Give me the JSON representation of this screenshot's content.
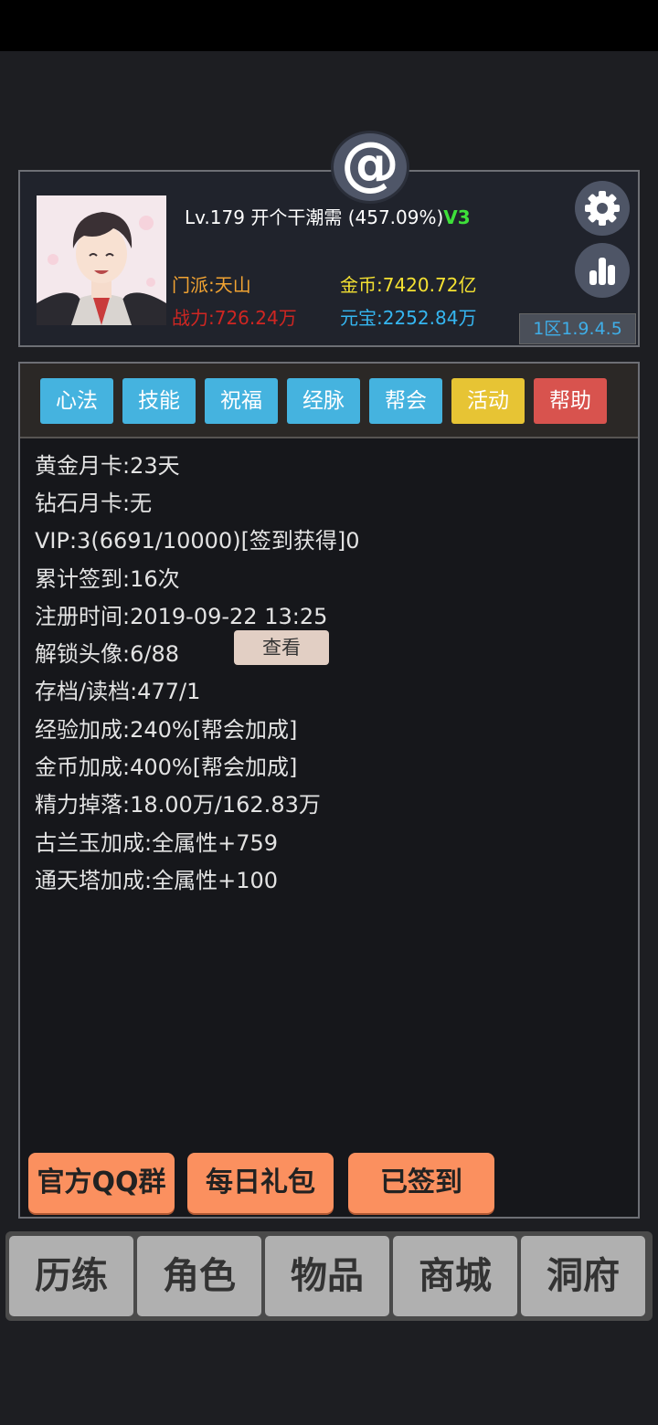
{
  "header": {
    "at_symbol": "@"
  },
  "profile": {
    "level": "Lv.179",
    "player_name": "开个干潮需",
    "exp_percent": "(457.09%)",
    "vip_tag": "V3",
    "sect": "门派:天山",
    "power": "战力:726.24万",
    "gold": "金币:7420.72亿",
    "ingot": "元宝:2252.84万",
    "version": "1区1.9.4.5",
    "icons": [
      "settings-icon",
      "stats-bar-chart-icon"
    ]
  },
  "tabs": [
    {
      "label": "心法",
      "color": "#45b3df"
    },
    {
      "label": "技能",
      "color": "#45b3df"
    },
    {
      "label": "祝福",
      "color": "#45b3df"
    },
    {
      "label": "经脉",
      "color": "#45b3df"
    },
    {
      "label": "帮会",
      "color": "#45b3df"
    },
    {
      "label": "活动",
      "color": "#e7c434"
    },
    {
      "label": "帮助",
      "color": "#d8534e"
    }
  ],
  "info": {
    "lines": [
      "黄金月卡:23天",
      "钻石月卡:无",
      "VIP:3(6691/10000)[签到获得]0",
      "累计签到:16次",
      "注册时间:2019-09-22 13:25",
      "解锁头像:6/88",
      "存档/读档:477/1",
      "经验加成:240%[帮会加成]",
      "金币加成:400%[帮会加成]",
      "精力掉落:18.00万/162.83万",
      "古兰玉加成:全属性+759",
      "通天塔加成:全属性+100"
    ],
    "view_button": "查看"
  },
  "actions": {
    "qq_group": "官方QQ群",
    "daily_gift": "每日礼包",
    "signed_in": "已签到"
  },
  "bottom_nav": [
    "历练",
    "角色",
    "物品",
    "商城",
    "洞府"
  ]
}
